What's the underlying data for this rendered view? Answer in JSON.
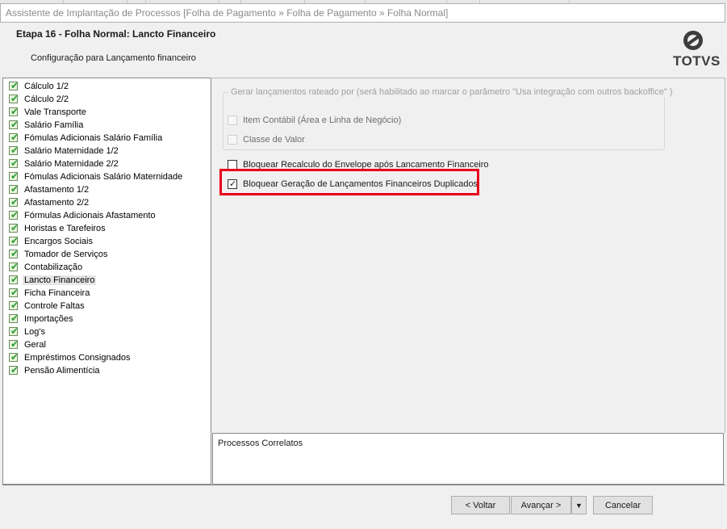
{
  "window": {
    "title": "Assistente de Implantação de Processos [Folha de Pagamento » Folha de Pagamento » Folha Normal]"
  },
  "header": {
    "step_title": "Etapa 16 - Folha Normal: Lancto Financeiro",
    "subtitle": "Configuração para Lançamento financeiro",
    "logo_text": "TOTVS"
  },
  "tree": {
    "items": [
      {
        "label": "Cálculo 1/2"
      },
      {
        "label": "Cálculo 2/2"
      },
      {
        "label": "Vale Transporte"
      },
      {
        "label": "Salário Família"
      },
      {
        "label": "Fómulas Adicionais Salário Família"
      },
      {
        "label": "Salário Maternidade 1/2"
      },
      {
        "label": "Salário Maternidade 2/2"
      },
      {
        "label": "Fómulas Adicionais Salário Maternidade"
      },
      {
        "label": "Afastamento 1/2"
      },
      {
        "label": "Afastamento 2/2"
      },
      {
        "label": "Fórmulas Adicionais Afastamento"
      },
      {
        "label": "Horistas e Tarefeiros"
      },
      {
        "label": "Encargos Sociais"
      },
      {
        "label": "Tomador de Serviços"
      },
      {
        "label": "Contabilização"
      },
      {
        "label": "Lancto Financeiro",
        "selected": true
      },
      {
        "label": "Ficha Financeira"
      },
      {
        "label": "Controle Faltas"
      },
      {
        "label": "Importações"
      },
      {
        "label": "Log's"
      },
      {
        "label": "Geral"
      },
      {
        "label": "Empréstimos Consignados"
      },
      {
        "label": "Pensão Alimentícia"
      }
    ]
  },
  "options": {
    "group_legend": "Gerar lançamentos rateado por (será habilitado ao marcar o parâmetro \"Usa integração com outros backoffice\" )",
    "item_contabil": {
      "label": "Item Contábil (Área e Linha de Negócio)",
      "checked": false,
      "enabled": false
    },
    "classe_valor": {
      "label": "Classe de Valor",
      "checked": false,
      "enabled": false
    },
    "bloquear_recalculo": {
      "label": "Bloquear Recalculo do Envelope após Lancamento Financeiro",
      "checked": false
    },
    "bloquear_duplicados": {
      "label": "Bloquear Geração de Lançamentos Financeiros Duplicados",
      "checked": true
    }
  },
  "related": {
    "label": "Processos Correlatos"
  },
  "buttons": {
    "back": "< Voltar",
    "next": "Avançar >",
    "dropdown": "▼",
    "cancel": "Cancelar"
  },
  "colors": {
    "highlight": "#e8001c",
    "check_green": "#2f9e2f"
  }
}
